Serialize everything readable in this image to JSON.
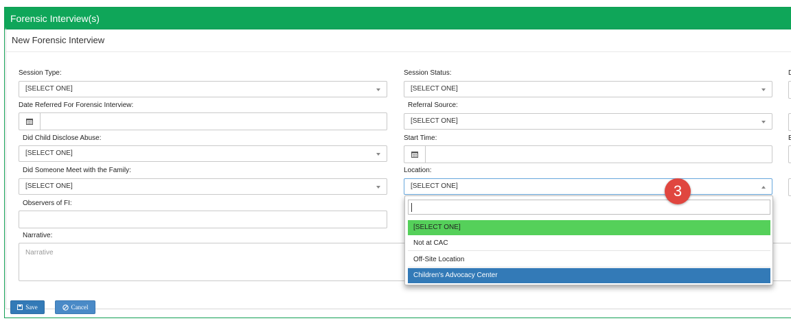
{
  "outer": {
    "title": "Forensic Interview(s)"
  },
  "form": {
    "title": "New Forensic Interview",
    "fields": {
      "session_type": {
        "label": "Session Type:",
        "value": "[SELECT ONE]"
      },
      "session_status": {
        "label": "Session Status:",
        "value": "[SELECT ONE]"
      },
      "date_referred": {
        "label": "Date Referred For Forensic Interview:",
        "value": ""
      },
      "referral_source": {
        "label": "Referral Source:",
        "value": "[SELECT ONE]"
      },
      "did_child_disclose": {
        "label": "Did Child Disclose Abuse:",
        "value": "[SELECT ONE]"
      },
      "start_time": {
        "label": "Start Time:",
        "value": ""
      },
      "did_someone_meet": {
        "label": "Did Someone Meet with the Family:",
        "value": "[SELECT ONE]"
      },
      "location": {
        "label": "Location:",
        "value": "[SELECT ONE]"
      },
      "observers": {
        "label": "Observers of FI:",
        "value": ""
      },
      "narrative": {
        "label": "Narrative:",
        "placeholder": "Narrative"
      }
    },
    "right_edge_labels": [
      "D",
      "E"
    ]
  },
  "location_dropdown": {
    "search_value": "",
    "options": [
      {
        "label": "[SELECT ONE]",
        "state": "selected"
      },
      {
        "label": "Not at CAC",
        "state": "normal"
      },
      {
        "label": "Off-Site Location",
        "state": "normal"
      },
      {
        "label": "Children's Advocacy Center",
        "state": "highlighted"
      }
    ]
  },
  "step_badge": "3",
  "buttons": {
    "save": "Save",
    "cancel": "Cancel"
  },
  "colors": {
    "header_green": "#0fa659",
    "selected_option": "#55d05a",
    "highlight_option": "#337ab7",
    "badge": "#e0463f",
    "button_blue": "#337ab7"
  }
}
